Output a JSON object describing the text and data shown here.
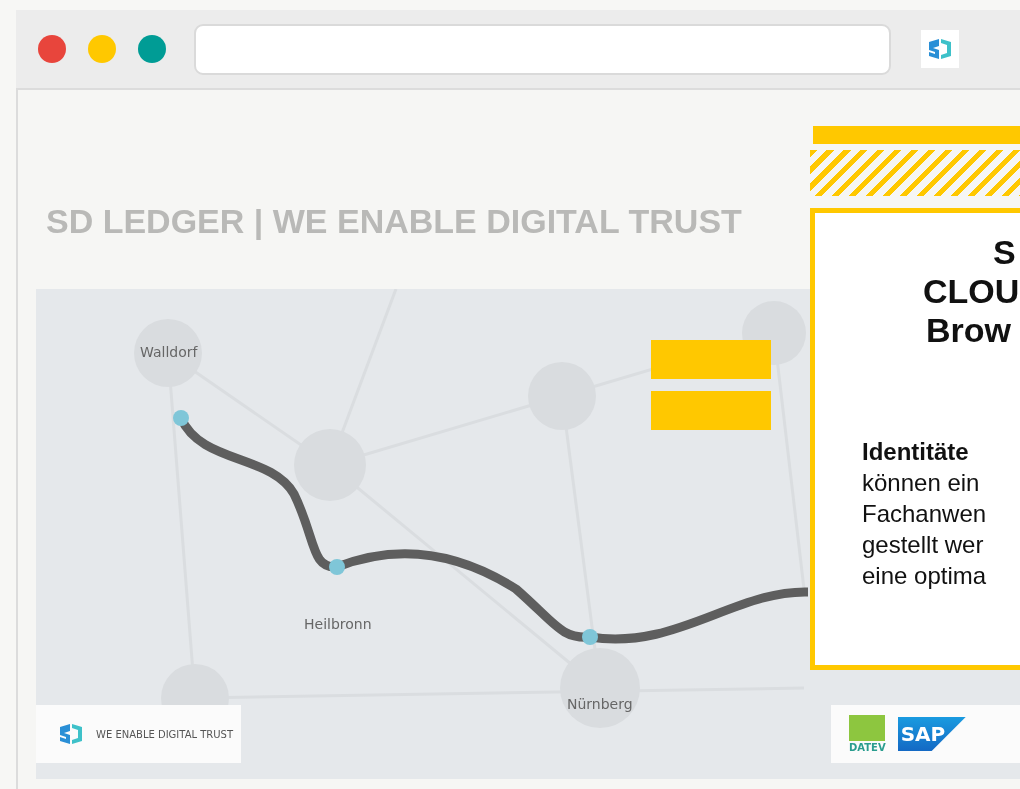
{
  "window_controls": [
    {
      "color": "#e8453c"
    },
    {
      "color": "#ffc800"
    },
    {
      "color": "#009c95"
    }
  ],
  "heading": "SD LEDGER | WE ENABLE DIGITAL TRUST",
  "map": {
    "places": [
      {
        "name": "Walldorf"
      },
      {
        "name": "Heilbronn"
      },
      {
        "name": "Nürnberg"
      }
    ]
  },
  "card": {
    "title_lines": [
      "S",
      "CLOU",
      "Brow"
    ],
    "body_lines": [
      "**Identitäte**",
      "können ein",
      "Fachanwen",
      "gestellt wer",
      "eine optima"
    ]
  },
  "footer": {
    "tagline": "WE ENABLE DIGITAL TRUST"
  },
  "partner_logos": [
    {
      "kind": "datev",
      "label": "DATEV"
    },
    {
      "kind": "sap",
      "label": "SAP"
    }
  ]
}
